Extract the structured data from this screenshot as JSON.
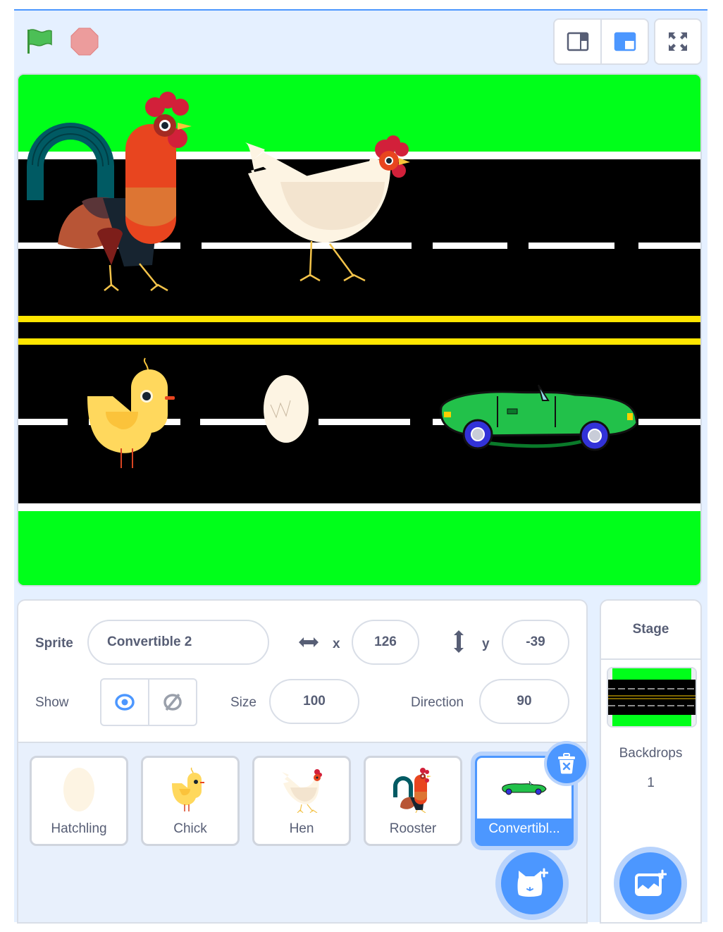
{
  "header": {
    "green_flag": {
      "icon": "green-flag-icon",
      "color": "#4cbf56"
    },
    "stop": {
      "icon": "stop-icon",
      "color": "#ec9c9c"
    },
    "layout_modes": [
      {
        "name": "small-stage",
        "icon": "small-stage-icon",
        "active": false
      },
      {
        "name": "normal-stage",
        "icon": "normal-stage-icon",
        "active": true
      }
    ],
    "fullscreen": {
      "icon": "fullscreen-icon"
    }
  },
  "stage": {
    "backdrop": "road",
    "sprites_visible": [
      "Rooster",
      "Hen",
      "Chick",
      "Hatchling",
      "Convertible 2"
    ]
  },
  "sprite_info": {
    "sprite_label": "Sprite",
    "sprite_name": "Convertible 2",
    "x_label": "x",
    "x_value": "126",
    "y_label": "y",
    "y_value": "-39",
    "show_label": "Show",
    "show_visible": true,
    "size_label": "Size",
    "size_value": "100",
    "direction_label": "Direction",
    "direction_value": "90"
  },
  "sprites": [
    {
      "name": "Hatchling",
      "selected": false
    },
    {
      "name": "Chick",
      "selected": false
    },
    {
      "name": "Hen",
      "selected": false
    },
    {
      "name": "Rooster",
      "selected": false
    },
    {
      "name": "Convertibl...",
      "selected": true
    }
  ],
  "stage_panel": {
    "title": "Stage",
    "backdrops_label": "Backdrops",
    "backdrops_count": "1"
  },
  "colors": {
    "accent": "#4c97ff",
    "accent_light": "#b8d3fc",
    "panel_bg": "#e5f0ff",
    "text": "#575e75",
    "grass": "#00ff1a",
    "road": "#000000",
    "yellow_line": "#ffe600"
  }
}
